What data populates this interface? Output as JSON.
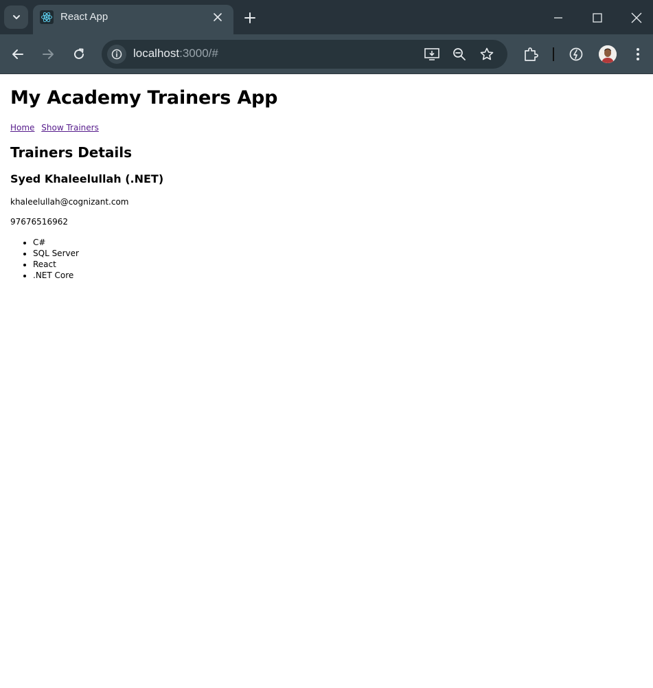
{
  "browser": {
    "tab": {
      "title": "React App",
      "favicon": "react-icon"
    },
    "omnibox": {
      "host": "localhost",
      "path": ":3000/#"
    },
    "colors": {
      "frame": "#27323a",
      "toolbar": "#3c4b54",
      "link": "#551a8b"
    }
  },
  "page": {
    "app_title": "My Academy Trainers App",
    "nav": {
      "home": "Home",
      "show_trainers": "Show Trainers"
    },
    "section_title": "Trainers Details",
    "trainer": {
      "name": "Syed Khaleelullah (.NET)",
      "email": "khaleelullah@cognizant.com",
      "phone": "97676516962",
      "skills": [
        "C#",
        "SQL Server",
        "React",
        ".NET Core"
      ]
    }
  }
}
